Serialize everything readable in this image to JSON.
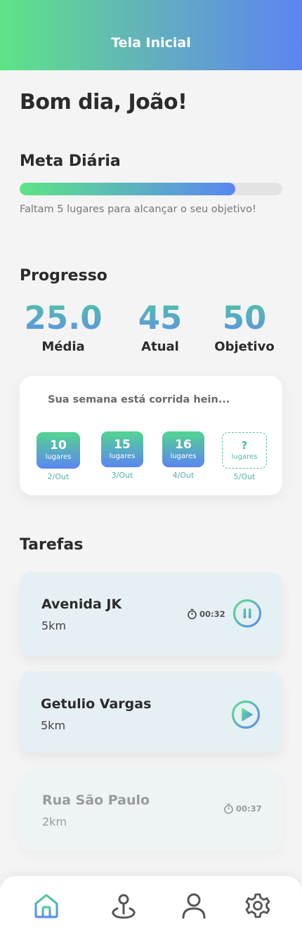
{
  "header": {
    "title": "Tela Inicial"
  },
  "greeting": "Bom dia, João!",
  "daily_goal": {
    "title": "Meta Diária",
    "progress": 0.82,
    "message": "Faltam 5 lugares para alcançar o seu objetivo!"
  },
  "progress": {
    "title": "Progresso",
    "stats": [
      {
        "value": "25.0",
        "label": "Média"
      },
      {
        "value": "45",
        "label": "Atual"
      },
      {
        "value": "50",
        "label": "Objetivo"
      }
    ]
  },
  "week": {
    "message": "Sua semana está corrida hein...",
    "days": [
      {
        "count": "10",
        "unit": "lugares",
        "date": "2/Out"
      },
      {
        "count": "15",
        "unit": "lugares",
        "date": "3/Out"
      },
      {
        "count": "16",
        "unit": "lugares",
        "date": "4/Out"
      },
      {
        "count": "?",
        "unit": "lugares",
        "date": "5/Out"
      }
    ]
  },
  "tasks": {
    "title": "Tarefas",
    "items": [
      {
        "name": "Avenida JK",
        "distance": "5km",
        "time": "00:32",
        "control": "pause-icon"
      },
      {
        "name": "Getulio Vargas",
        "distance": "5km",
        "control": "play-icon"
      },
      {
        "name": "Rua São Paulo",
        "distance": "2km",
        "time": "00:37"
      }
    ]
  },
  "tabbar": {
    "items": [
      {
        "icon": "home-icon",
        "active": true
      },
      {
        "icon": "map-pin-icon"
      },
      {
        "icon": "user-icon"
      },
      {
        "icon": "gear-icon"
      }
    ],
    "active_color": "#4fb8b0"
  },
  "colors": {
    "gradient_start": "#5de486",
    "gradient_end": "#5c84f2"
  }
}
